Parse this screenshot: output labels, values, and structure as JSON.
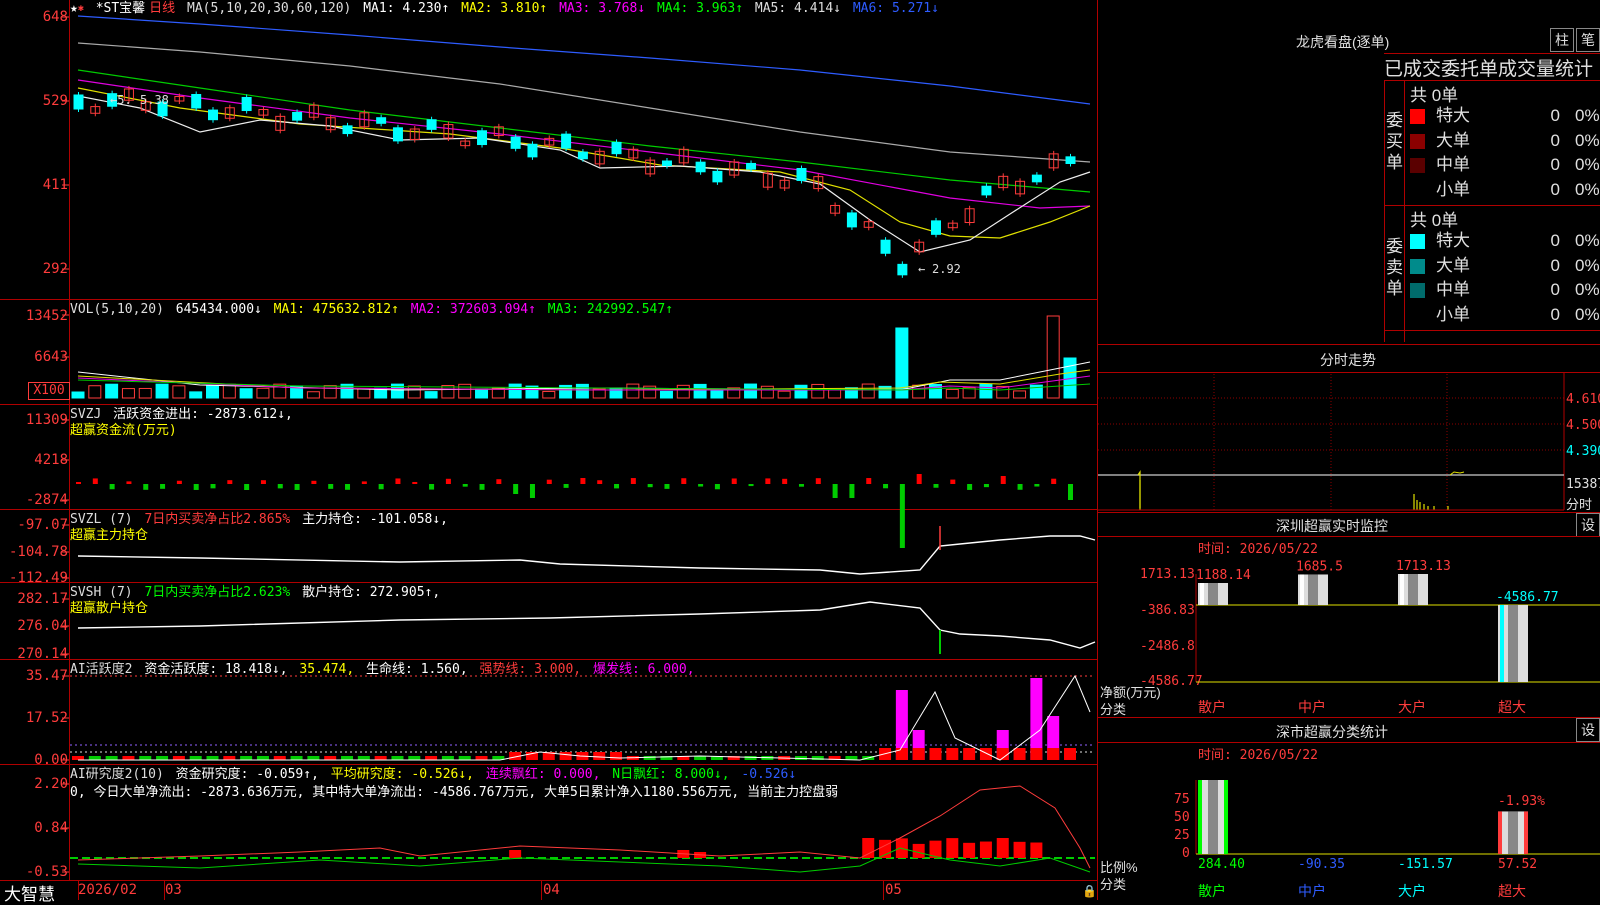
{
  "main": {
    "stock_name": "*ST宝馨",
    "period": "日线",
    "ma_params": "MA(5,10,20,30,60,120)",
    "ma1": "MA1: 4.230↑",
    "ma2": "MA2: 3.810↑",
    "ma3": "MA3: 3.768↓",
    "ma4": "MA4: 3.963↑",
    "ma5": "MA5: 4.414↓",
    "ma6": "MA6: 5.271↓",
    "axis": [
      "648",
      "529",
      "411",
      "292"
    ],
    "high_label": "5.38",
    "low_label": "2.92"
  },
  "vol": {
    "params": "VOL(5,10,20)",
    "value": "645434.000↓",
    "ma1": "MA1: 475632.812↑",
    "ma2": "MA2: 372603.094↑",
    "ma3": "MA3: 242992.547↑",
    "axis": [
      "13452",
      "6643"
    ],
    "unit": "X100"
  },
  "svzj": {
    "name": "SVZJ",
    "desc": "活跃资金进出: -2873.612↓,",
    "sub": "超赢资金流(万元)",
    "axis": [
      "11309",
      "4218",
      "-2874"
    ]
  },
  "svzl": {
    "name": "SVZL (7)",
    "ratio": "7日内买卖净占比2.865%",
    "hold": "主力持仓: -101.058↓,",
    "sub": "超赢主力持仓",
    "axis": [
      "-97.07",
      "-104.78",
      "-112.49"
    ]
  },
  "svsh": {
    "name": "SVSH (7)",
    "ratio": "7日内买卖净占比2.623%",
    "hold": "散户持仓: 272.905↑,",
    "sub": "超赢散户持仓",
    "axis": [
      "282.17",
      "276.04",
      "270.14"
    ]
  },
  "ai1": {
    "name": "AI活跃度2",
    "v1": "资金活跃度: 18.418↓,",
    "v2": "35.474,",
    "v3": "生命线: 1.560,",
    "v4": "强势线: 3.000,",
    "v5": "爆发线: 6.000,",
    "axis": [
      "35.47",
      "17.52",
      "0.00"
    ]
  },
  "ai2": {
    "name": "AI研究度2(10)",
    "v1": "资金研究度: -0.059↑,",
    "v2": "平均研究度: -0.526↓,",
    "v3": "连续飘红: 0.000,",
    "v4": "N日飘红: 8.000↓,",
    "v5": "-0.526↓",
    "line2": "0, 今日大单净流出: -2873.636万元, 其中特大单净流出: -4586.767万元, 大单5日累计净入1180.556万元, 当前主力控盘弱",
    "axis": [
      "2.20",
      "0.84",
      "-0.53"
    ]
  },
  "bottom": {
    "brand": "大智慧",
    "dates": [
      "2026/02",
      "03",
      "04",
      "05"
    ]
  },
  "dragon": {
    "title": "龙虎看盘(逐单)",
    "btn1": "柱",
    "btn2": "笔",
    "subtitle": "已成交委托单成交量统计",
    "buy_label": "委买单",
    "sell_label": "委卖单",
    "buy_total": "共 0单",
    "sell_total": "共 0单",
    "buy_rows": [
      {
        "label": "特大",
        "val": "0",
        "pct": "0%",
        "color": "#ff0000"
      },
      {
        "label": "大单",
        "val": "0",
        "pct": "0%",
        "color": "#8b0000"
      },
      {
        "label": "中单",
        "val": "0",
        "pct": "0%",
        "color": "#5a0000"
      },
      {
        "label": "小单",
        "val": "0",
        "pct": "0%",
        "color": "#000000"
      }
    ],
    "sell_rows": [
      {
        "label": "特大",
        "val": "0",
        "pct": "0%",
        "color": "#00ffff"
      },
      {
        "label": "大单",
        "val": "0",
        "pct": "0%",
        "color": "#008b8b"
      },
      {
        "label": "中单",
        "val": "0",
        "pct": "0%",
        "color": "#006b6b"
      },
      {
        "label": "小单",
        "val": "0",
        "pct": "0%",
        "color": "#000000"
      }
    ]
  },
  "intraday": {
    "title": "分时走势",
    "axis": [
      "4.610",
      "4.500",
      "4.390",
      "15387"
    ],
    "unit": "分时"
  },
  "sz_monitor": {
    "title": "深圳超赢实时监控",
    "settings": "设",
    "time": "时间: 2026/05/22",
    "axis": [
      "1713.13",
      "-386.83",
      "-2486.8",
      "-4586.77"
    ],
    "unit": "净额(万元)",
    "cat": "分类",
    "labels": [
      "散户",
      "中户",
      "大户",
      "超大"
    ]
  },
  "sz_class": {
    "title": "深市超赢分类统计",
    "settings": "设",
    "time": "时间: 2026/05/22",
    "axis": [
      "75",
      "50",
      "25",
      "0"
    ],
    "unit": "比例%",
    "cat": "分类",
    "values": [
      "284.40",
      "-90.35",
      "-151.57",
      "57.52"
    ],
    "top_label": "-1.93%",
    "labels": [
      "散户",
      "中户",
      "大户",
      "超大"
    ]
  },
  "chart_data": [
    {
      "type": "bar",
      "title": "深圳超赢实时监控",
      "categories": [
        "散户",
        "中户",
        "大户",
        "超大"
      ],
      "values": [
        1188.14,
        1685.5,
        1713.13,
        -4586.77
      ],
      "ylim": [
        -4586.77,
        1713.13
      ]
    },
    {
      "type": "bar",
      "title": "深市超赢分类统计",
      "categories": [
        "散户",
        "中户",
        "大户",
        "超大"
      ],
      "values": [
        284.4,
        -90.35,
        -151.57,
        57.52
      ],
      "ylim": [
        0,
        100
      ]
    }
  ]
}
